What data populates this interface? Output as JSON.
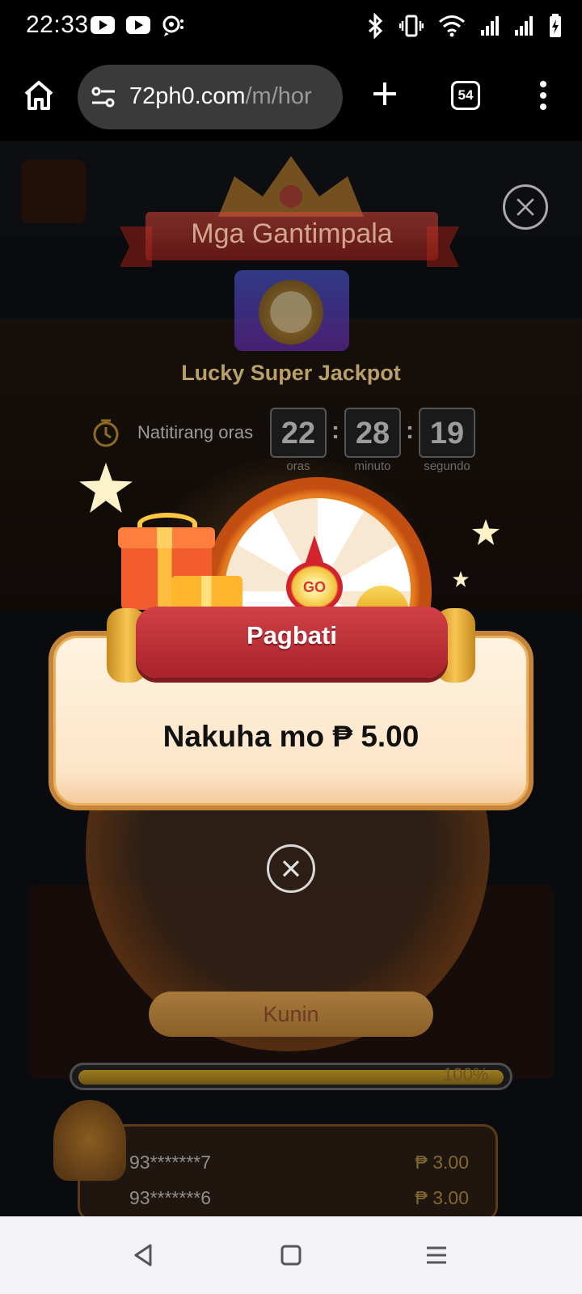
{
  "status_bar": {
    "time": "22:33"
  },
  "browser": {
    "url_host": "72ph0.com",
    "url_path": "/m/hor",
    "tab_count": "54"
  },
  "reward_panel": {
    "title": "Mga Gantimpala",
    "jackpot_title": "Lucky Super Jackpot",
    "timer_label": "Natitirang oras",
    "timer": [
      {
        "value": "22",
        "unit": "oras"
      },
      {
        "value": "28",
        "unit": "minuto"
      },
      {
        "value": "19",
        "unit": "segundo"
      }
    ],
    "collect_label": "Kunin",
    "progress_text": "100%",
    "progress": 1.0,
    "winners": [
      {
        "user": "93*******7",
        "amount": "₱ 3.00"
      },
      {
        "user": "93*******6",
        "amount": "₱ 3.00"
      }
    ]
  },
  "popup": {
    "title": "Pagbati",
    "message": "Nakuha mo ₱ 5.00",
    "go_label": "GO"
  },
  "colors": {
    "accent": "#c6843a",
    "banner_red": "#d14046",
    "card_bg": "#fff3e0"
  }
}
